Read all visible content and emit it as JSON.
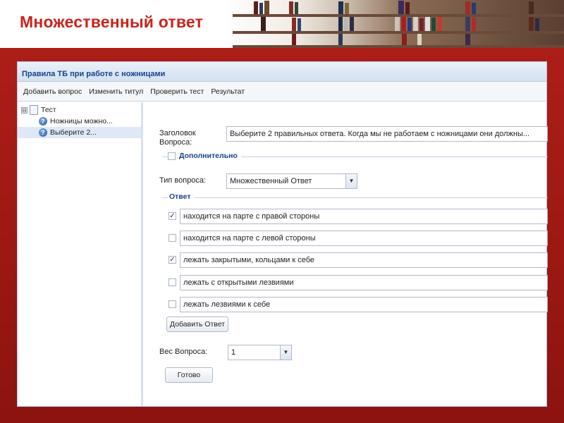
{
  "slide": {
    "title": "Множественный ответ"
  },
  "window": {
    "title": "Правила ТБ при работе с ножницами",
    "menu": [
      "Добавить вопрос",
      "Изменить титул",
      "Проверить тест",
      "Результат"
    ]
  },
  "tree": {
    "root": {
      "label": "Тест",
      "toggle": "⊟"
    },
    "items": [
      {
        "label": "Ножницы можно...",
        "icon": "question-icon"
      },
      {
        "label": "Выберите 2...",
        "icon": "question-icon",
        "selected": true
      }
    ]
  },
  "form": {
    "question_title_label": "Заголовок Вопроса:",
    "question_title_value": "Выберите 2 правильных ответа. Когда мы не работаем с ножницами они должны...",
    "additional_label": "Дополнительно",
    "question_type_label": "Тип вопроса:",
    "question_type_value": "Множественный Ответ",
    "answer_legend": "Ответ",
    "answers": [
      {
        "text": "находится на парте с правой стороны",
        "checked": true
      },
      {
        "text": "находится на парте с левой стороны",
        "checked": false
      },
      {
        "text": "лежать закрытыми, кольцами к себе",
        "checked": true
      },
      {
        "text": "лежать с открытыми лезвиями",
        "checked": false
      },
      {
        "text": "лежать лезвиями к себе",
        "checked": false
      }
    ],
    "add_answer_button": "Добавить Ответ",
    "weight_label": "Вес Вопроса:",
    "weight_value": "1",
    "done_button": "Готово"
  },
  "colors": {
    "slide_background": "#a81c16",
    "slide_title": "#c8241a",
    "window_title": "#15428b"
  }
}
